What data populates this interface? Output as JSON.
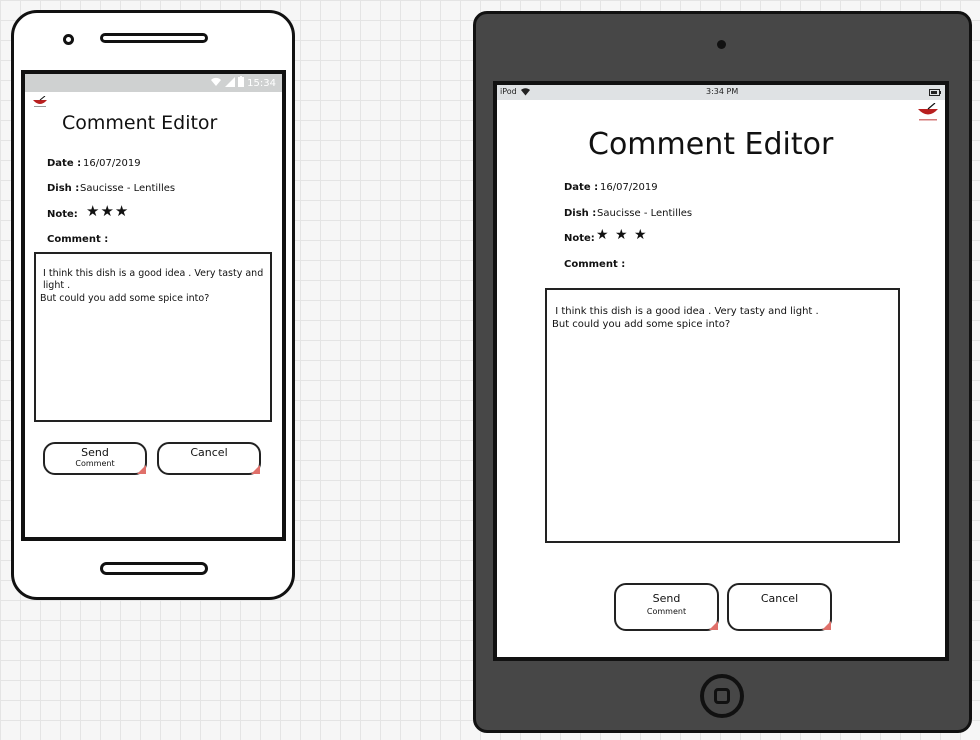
{
  "phone": {
    "status_time": "15:34",
    "title": "Comment Editor",
    "date_label": "Date :",
    "date_value": "16/07/2019",
    "dish_label": "Dish :",
    "dish_value": "Saucisse - Lentilles",
    "note_label": "Note:",
    "stars": "★★★",
    "comment_label": "Comment :",
    "comment_text": " I think this dish is a good idea . Very tasty and\n light .\nBut could you add some spice into?",
    "send_label": "Send",
    "send_sublabel": "Comment",
    "cancel_label": "Cancel"
  },
  "tablet": {
    "status_device": "iPod",
    "status_time": "3:34 PM",
    "title": "Comment Editor",
    "date_label": "Date :",
    "date_value": "16/07/2019",
    "dish_label": "Dish :",
    "dish_value": "Saucisse - Lentilles",
    "note_label": "Note:",
    "stars": "★ ★ ★",
    "comment_label": "Comment :",
    "comment_text": " I think this dish is a good idea . Very tasty and light .\nBut could you add some spice into?",
    "send_label": "Send",
    "send_sublabel": "Comment",
    "cancel_label": "Cancel"
  },
  "icons": {
    "logo": "food-bowl-logo-icon",
    "wifi": "wifi-icon",
    "signal": "signal-icon",
    "battery": "battery-icon",
    "note_stars": "star-icon",
    "link_corner": "link-corner-icon"
  },
  "colors": {
    "logo_red": "#b81f1f",
    "corner_link": "#e0706a",
    "tablet_frame": "#474747",
    "status_bar_phone": "#cfd1d1",
    "status_bar_tablet": "#dfe2e4"
  }
}
